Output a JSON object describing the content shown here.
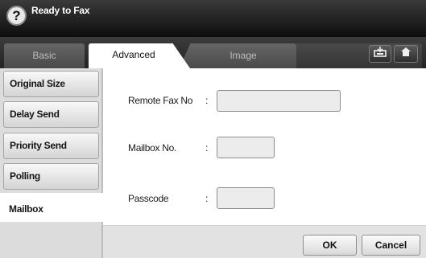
{
  "header": {
    "help_glyph": "?",
    "title": "Ready to Fax"
  },
  "tabs": [
    {
      "label": "Basic",
      "active": false
    },
    {
      "label": "Advanced",
      "active": true
    },
    {
      "label": "Image",
      "active": false
    }
  ],
  "toolbar_icons": {
    "tray": "tray-icon",
    "home": "home-icon"
  },
  "sidebar": {
    "items": [
      {
        "label": "Original Size",
        "active": false
      },
      {
        "label": "Delay Send",
        "active": false
      },
      {
        "label": "Priority Send",
        "active": false
      },
      {
        "label": "Polling",
        "active": false
      },
      {
        "label": "Mailbox",
        "active": true
      }
    ]
  },
  "form": {
    "remote_fax_label": "Remote Fax No",
    "remote_fax_value": "",
    "mailbox_label": "Mailbox No.",
    "mailbox_value": "",
    "passcode_label": "Passcode",
    "passcode_value": "",
    "separator": ":"
  },
  "actions": {
    "ok_label": "OK",
    "cancel_label": "Cancel"
  }
}
